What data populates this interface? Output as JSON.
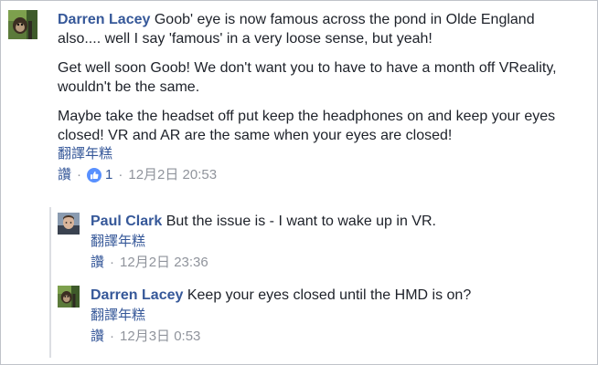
{
  "comments": [
    {
      "author": "Darren Lacey",
      "paragraphs": [
        "Goob' eye is now famous across the pond in Olde England also.... well I say 'famous' in a very loose sense, but yeah!",
        "Get well soon Goob! We don't want you to have to have a month off VReality, wouldn't be the same.",
        "Maybe take the headset off put keep the headphones on and keep your eyes closed! VR and AR are the same when your eyes are closed!"
      ],
      "translate": "翻譯年糕",
      "like": "讚",
      "likes": "1",
      "time": "12月2日 20:53"
    }
  ],
  "replies": [
    {
      "author": "Paul Clark",
      "text": "But the issue is - I want to wake up in VR.",
      "translate": "翻譯年糕",
      "like": "讚",
      "time": "12月2日 23:36"
    },
    {
      "author": "Darren Lacey",
      "text": "Keep your eyes closed until the HMD is on?",
      "translate": "翻譯年糕",
      "like": "讚",
      "time": "12月3日 0:53"
    }
  ],
  "separator": "·",
  "colors": {
    "link": "#365899",
    "meta": "#90949c",
    "like_badge": "#5890ff",
    "text": "#1d2129"
  }
}
